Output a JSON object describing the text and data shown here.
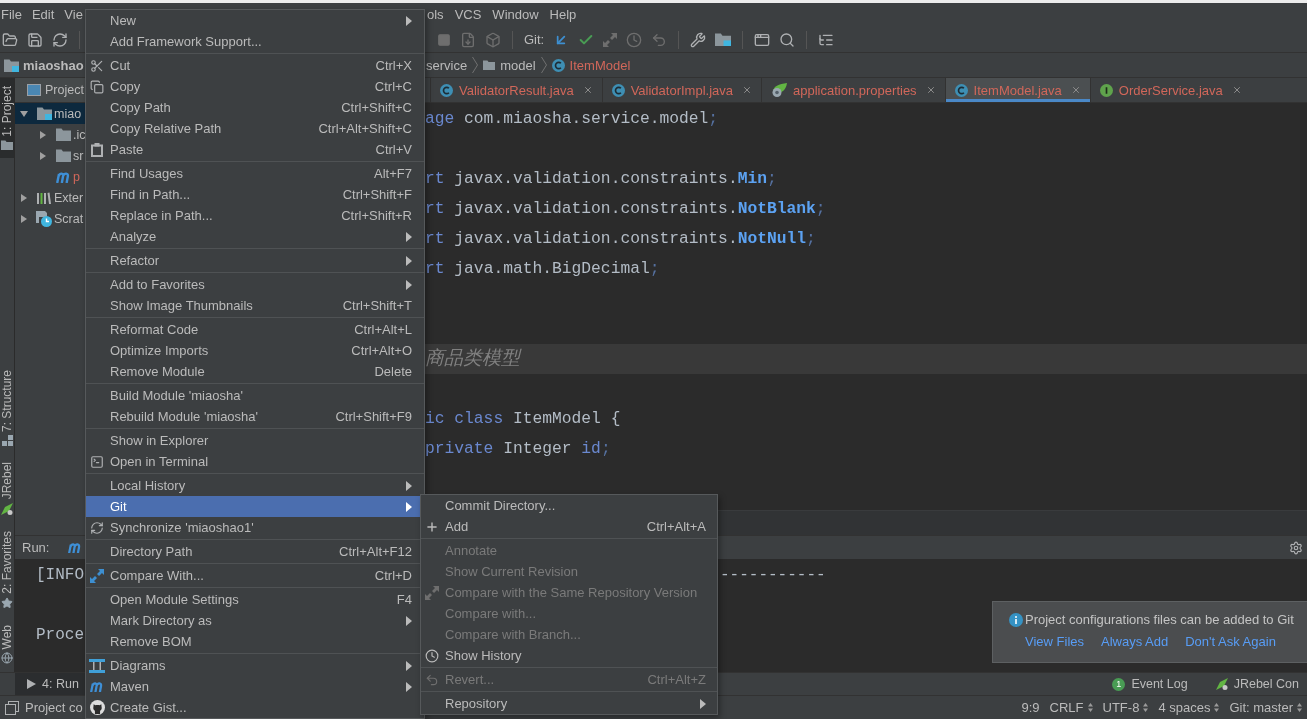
{
  "menu_bar": {
    "left": [
      "File",
      "Edit",
      "Vie"
    ],
    "right": [
      "ols",
      "VCS",
      "Window",
      "Help"
    ]
  },
  "toolbar": {
    "vcs_label": "Git:"
  },
  "navigation_bar": {
    "project": "miaoshao",
    "path": [
      {
        "label": "service",
        "kind": "plain",
        "color": "#bbbbbb"
      },
      {
        "label": "model",
        "kind": "folder",
        "color": "#bbbbbb"
      },
      {
        "label": "ItemModel",
        "kind": "class",
        "color": "#d1675a"
      }
    ]
  },
  "tool_strip": {
    "top": [
      {
        "label": "1: Project",
        "kind": "project",
        "selected": true
      }
    ],
    "bottom": [
      {
        "label": "7: Structure",
        "kind": "structure",
        "selected": false
      },
      {
        "label": "JRebel",
        "kind": "jrebel",
        "selected": false
      },
      {
        "label": "2: Favorites",
        "kind": "favorites",
        "selected": false
      },
      {
        "label": "Web",
        "kind": "web",
        "selected": false
      }
    ]
  },
  "project_panel": {
    "title": "Project",
    "tree": [
      {
        "label": "miao",
        "kind": "module",
        "expanded": true,
        "selected": true,
        "color": "#bbbbbb",
        "children": [
          {
            "label": ".ic",
            "kind": "folder",
            "expanded": false,
            "selected": false,
            "color": "#bbbbbb"
          },
          {
            "label": "sr",
            "kind": "folder",
            "expanded": false,
            "selected": false,
            "color": "#bbbbbb"
          },
          {
            "label": "p",
            "kind": "maven",
            "selected": false,
            "color": "#d1675a"
          }
        ]
      },
      {
        "label": "Exter",
        "kind": "libraries",
        "expanded": false,
        "selected": false,
        "color": "#bbbbbb"
      },
      {
        "label": "Scrat",
        "kind": "scratches",
        "expanded": false,
        "selected": false,
        "color": "#bbbbbb"
      }
    ]
  },
  "editor": {
    "tabs": [
      {
        "label": "ValidatorResult.java",
        "kind": "class",
        "selected": false
      },
      {
        "label": "ValidatorImpl.java",
        "kind": "class",
        "selected": false
      },
      {
        "label": "application.properties",
        "kind": "properties",
        "selected": false
      },
      {
        "label": "ItemModel.java",
        "kind": "class",
        "selected": true
      },
      {
        "label": "OrderService.java",
        "kind": "interface",
        "selected": false
      }
    ],
    "lines": [
      {
        "kind": "code",
        "current": false,
        "tokens": [
          {
            "kind": "keyword",
            "text": "age"
          },
          {
            "kind": "plain",
            "text": " com.miaosha.service.model"
          },
          {
            "kind": "punct",
            "text": ";"
          }
        ]
      },
      {
        "kind": "blank",
        "current": false
      },
      {
        "kind": "code",
        "current": false,
        "tokens": [
          {
            "kind": "keyword",
            "text": "rt"
          },
          {
            "kind": "plain",
            "text": " javax.validation.constraints."
          },
          {
            "kind": "type",
            "text": "Min"
          },
          {
            "kind": "punct",
            "text": ";"
          }
        ]
      },
      {
        "kind": "code",
        "current": false,
        "tokens": [
          {
            "kind": "keyword",
            "text": "rt"
          },
          {
            "kind": "plain",
            "text": " javax.validation.constraints."
          },
          {
            "kind": "type",
            "text": "NotBlank"
          },
          {
            "kind": "punct",
            "text": ";"
          }
        ]
      },
      {
        "kind": "code",
        "current": false,
        "tokens": [
          {
            "kind": "keyword",
            "text": "rt"
          },
          {
            "kind": "plain",
            "text": " javax.validation.constraints."
          },
          {
            "kind": "type",
            "text": "NotNull"
          },
          {
            "kind": "punct",
            "text": ";"
          }
        ]
      },
      {
        "kind": "code",
        "current": false,
        "tokens": [
          {
            "kind": "keyword",
            "text": "rt"
          },
          {
            "kind": "plain",
            "text": " java.math.BigDecimal"
          },
          {
            "kind": "punct",
            "text": ";"
          }
        ]
      },
      {
        "kind": "blank",
        "current": false
      },
      {
        "kind": "blank",
        "current": false
      },
      {
        "kind": "comment",
        "current": true,
        "text": "商品类模型"
      },
      {
        "kind": "blank",
        "current": false
      },
      {
        "kind": "code",
        "current": false,
        "tokens": [
          {
            "kind": "keyword",
            "text": "ic class"
          },
          {
            "kind": "plain",
            "text": " ItemModel {"
          }
        ]
      },
      {
        "kind": "code",
        "current": false,
        "tokens": [
          {
            "kind": "keyword",
            "text": "private"
          },
          {
            "kind": "plain",
            "text": " Integer "
          },
          {
            "kind": "field",
            "text": "id"
          },
          {
            "kind": "punct",
            "text": ";"
          }
        ]
      }
    ]
  },
  "run_panel": {
    "title": "Run:",
    "console": [
      {
        "kind": "text",
        "text": "[INFO",
        "tail": "-----------"
      },
      {
        "kind": "blank"
      },
      {
        "kind": "text",
        "text": "Proce"
      }
    ]
  },
  "notification": {
    "message": "Project configurations files can be added to Git",
    "actions": [
      "View Files",
      "Always Add",
      "Don't Ask Again"
    ]
  },
  "bottom_bar": {
    "left": [
      {
        "label": "4: Run",
        "kind": "run",
        "selected": true
      }
    ],
    "right": [
      {
        "label": "Event Log",
        "kind": "event-log",
        "badge": "1",
        "selected": false
      },
      {
        "label": "JRebel Con",
        "kind": "jrebel",
        "selected": false
      }
    ]
  },
  "status_bar": {
    "message": "Project co",
    "items": [
      {
        "text": "9:9",
        "dropdown": false
      },
      {
        "text": "CRLF",
        "dropdown": true
      },
      {
        "text": "UTF-8",
        "dropdown": true
      },
      {
        "text": "4 spaces",
        "dropdown": true
      },
      {
        "text": "Git: master",
        "dropdown": true
      }
    ]
  },
  "context_menu": {
    "groups": [
      {
        "items": [
          {
            "label": "New",
            "submenu": true,
            "selected": false
          },
          {
            "label": "Add Framework Support...",
            "submenu": false,
            "selected": false
          }
        ]
      },
      {
        "items": [
          {
            "label": "Cut",
            "shortcut": "Ctrl+X",
            "submenu": false,
            "selected": false
          },
          {
            "label": "Copy",
            "shortcut": "Ctrl+C",
            "submenu": false,
            "selected": false
          },
          {
            "label": "Copy Path",
            "shortcut": "Ctrl+Shift+C",
            "submenu": false,
            "selected": false
          },
          {
            "label": "Copy Relative Path",
            "shortcut": "Ctrl+Alt+Shift+C",
            "submenu": false,
            "selected": false
          },
          {
            "label": "Paste",
            "shortcut": "Ctrl+V",
            "submenu": false,
            "selected": false
          }
        ]
      },
      {
        "items": [
          {
            "label": "Find Usages",
            "shortcut": "Alt+F7",
            "submenu": false,
            "selected": false
          },
          {
            "label": "Find in Path...",
            "shortcut": "Ctrl+Shift+F",
            "submenu": false,
            "selected": false
          },
          {
            "label": "Replace in Path...",
            "shortcut": "Ctrl+Shift+R",
            "submenu": false,
            "selected": false
          },
          {
            "label": "Analyze",
            "submenu": true,
            "selected": false
          }
        ]
      },
      {
        "items": [
          {
            "label": "Refactor",
            "submenu": true,
            "selected": false
          }
        ]
      },
      {
        "items": [
          {
            "label": "Add to Favorites",
            "submenu": true,
            "selected": false
          },
          {
            "label": "Show Image Thumbnails",
            "shortcut": "Ctrl+Shift+T",
            "submenu": false,
            "selected": false
          }
        ]
      },
      {
        "items": [
          {
            "label": "Reformat Code",
            "shortcut": "Ctrl+Alt+L",
            "submenu": false,
            "selected": false
          },
          {
            "label": "Optimize Imports",
            "shortcut": "Ctrl+Alt+O",
            "submenu": false,
            "selected": false
          },
          {
            "label": "Remove Module",
            "shortcut": "Delete",
            "submenu": false,
            "selected": false
          }
        ]
      },
      {
        "items": [
          {
            "label": "Build Module 'miaosha'",
            "submenu": false,
            "selected": false
          },
          {
            "label": "Rebuild Module 'miaosha'",
            "shortcut": "Ctrl+Shift+F9",
            "submenu": false,
            "selected": false
          }
        ]
      },
      {
        "items": [
          {
            "label": "Show in Explorer",
            "submenu": false,
            "selected": false
          },
          {
            "label": "Open in Terminal",
            "submenu": false,
            "selected": false
          }
        ]
      },
      {
        "items": [
          {
            "label": "Local History",
            "submenu": true,
            "selected": false
          },
          {
            "label": "Git",
            "submenu": true,
            "selected": true
          },
          {
            "label": "Synchronize 'miaoshao1'",
            "submenu": false,
            "selected": false
          }
        ]
      },
      {
        "items": [
          {
            "label": "Directory Path",
            "shortcut": "Ctrl+Alt+F12",
            "submenu": false,
            "selected": false
          }
        ]
      },
      {
        "items": [
          {
            "label": "Compare With...",
            "shortcut": "Ctrl+D",
            "submenu": false,
            "selected": false
          }
        ]
      },
      {
        "items": [
          {
            "label": "Open Module Settings",
            "shortcut": "F4",
            "submenu": false,
            "selected": false
          },
          {
            "label": "Mark Directory as",
            "submenu": true,
            "selected": false
          },
          {
            "label": "Remove BOM",
            "submenu": false,
            "selected": false
          }
        ]
      },
      {
        "items": [
          {
            "label": "Diagrams",
            "submenu": true,
            "selected": false
          },
          {
            "label": "Maven",
            "submenu": true,
            "selected": false
          },
          {
            "label": "Create Gist...",
            "submenu": false,
            "selected": false
          }
        ]
      }
    ]
  },
  "git_submenu": {
    "groups": [
      {
        "items": [
          {
            "label": "Commit Directory...",
            "submenu": false,
            "selected": false,
            "disabled": false
          },
          {
            "label": "Add",
            "shortcut": "Ctrl+Alt+A",
            "submenu": false,
            "selected": false,
            "disabled": false
          }
        ]
      },
      {
        "items": [
          {
            "label": "Annotate",
            "submenu": false,
            "selected": false,
            "disabled": true
          },
          {
            "label": "Show Current Revision",
            "submenu": false,
            "selected": false,
            "disabled": true
          },
          {
            "label": "Compare with the Same Repository Version",
            "submenu": false,
            "selected": false,
            "disabled": true
          },
          {
            "label": "Compare with...",
            "submenu": false,
            "selected": false,
            "disabled": true
          },
          {
            "label": "Compare with Branch...",
            "submenu": false,
            "selected": false,
            "disabled": true
          },
          {
            "label": "Show History",
            "submenu": false,
            "selected": false,
            "disabled": false
          }
        ]
      },
      {
        "items": [
          {
            "label": "Revert...",
            "shortcut": "Ctrl+Alt+Z",
            "submenu": false,
            "selected": false,
            "disabled": true
          }
        ]
      },
      {
        "items": [
          {
            "label": "Repository",
            "submenu": true,
            "selected": false,
            "disabled": false
          }
        ]
      }
    ]
  }
}
